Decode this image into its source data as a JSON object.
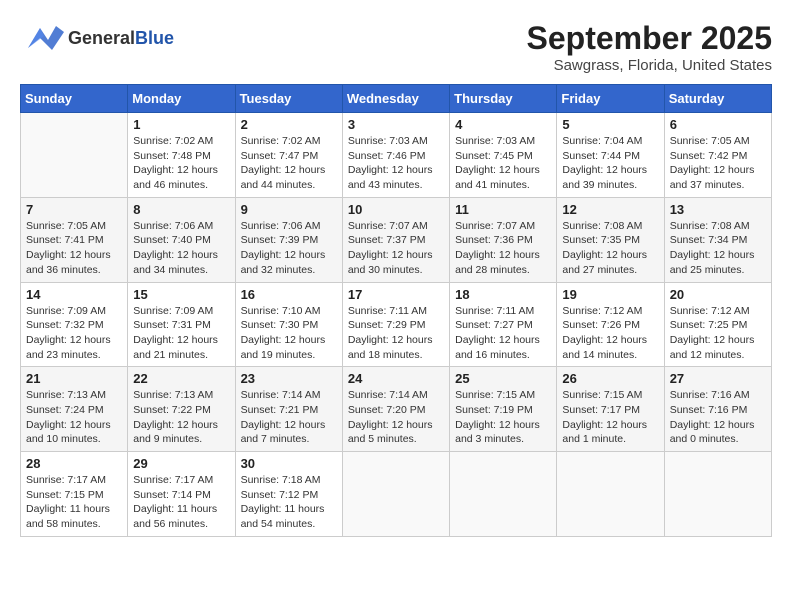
{
  "header": {
    "logo_general": "General",
    "logo_blue": "Blue",
    "title": "September 2025",
    "subtitle": "Sawgrass, Florida, United States"
  },
  "weekdays": [
    "Sunday",
    "Monday",
    "Tuesday",
    "Wednesday",
    "Thursday",
    "Friday",
    "Saturday"
  ],
  "weeks": [
    [
      {
        "day": "",
        "info": ""
      },
      {
        "day": "1",
        "info": "Sunrise: 7:02 AM\nSunset: 7:48 PM\nDaylight: 12 hours\nand 46 minutes."
      },
      {
        "day": "2",
        "info": "Sunrise: 7:02 AM\nSunset: 7:47 PM\nDaylight: 12 hours\nand 44 minutes."
      },
      {
        "day": "3",
        "info": "Sunrise: 7:03 AM\nSunset: 7:46 PM\nDaylight: 12 hours\nand 43 minutes."
      },
      {
        "day": "4",
        "info": "Sunrise: 7:03 AM\nSunset: 7:45 PM\nDaylight: 12 hours\nand 41 minutes."
      },
      {
        "day": "5",
        "info": "Sunrise: 7:04 AM\nSunset: 7:44 PM\nDaylight: 12 hours\nand 39 minutes."
      },
      {
        "day": "6",
        "info": "Sunrise: 7:05 AM\nSunset: 7:42 PM\nDaylight: 12 hours\nand 37 minutes."
      }
    ],
    [
      {
        "day": "7",
        "info": "Sunrise: 7:05 AM\nSunset: 7:41 PM\nDaylight: 12 hours\nand 36 minutes."
      },
      {
        "day": "8",
        "info": "Sunrise: 7:06 AM\nSunset: 7:40 PM\nDaylight: 12 hours\nand 34 minutes."
      },
      {
        "day": "9",
        "info": "Sunrise: 7:06 AM\nSunset: 7:39 PM\nDaylight: 12 hours\nand 32 minutes."
      },
      {
        "day": "10",
        "info": "Sunrise: 7:07 AM\nSunset: 7:37 PM\nDaylight: 12 hours\nand 30 minutes."
      },
      {
        "day": "11",
        "info": "Sunrise: 7:07 AM\nSunset: 7:36 PM\nDaylight: 12 hours\nand 28 minutes."
      },
      {
        "day": "12",
        "info": "Sunrise: 7:08 AM\nSunset: 7:35 PM\nDaylight: 12 hours\nand 27 minutes."
      },
      {
        "day": "13",
        "info": "Sunrise: 7:08 AM\nSunset: 7:34 PM\nDaylight: 12 hours\nand 25 minutes."
      }
    ],
    [
      {
        "day": "14",
        "info": "Sunrise: 7:09 AM\nSunset: 7:32 PM\nDaylight: 12 hours\nand 23 minutes."
      },
      {
        "day": "15",
        "info": "Sunrise: 7:09 AM\nSunset: 7:31 PM\nDaylight: 12 hours\nand 21 minutes."
      },
      {
        "day": "16",
        "info": "Sunrise: 7:10 AM\nSunset: 7:30 PM\nDaylight: 12 hours\nand 19 minutes."
      },
      {
        "day": "17",
        "info": "Sunrise: 7:11 AM\nSunset: 7:29 PM\nDaylight: 12 hours\nand 18 minutes."
      },
      {
        "day": "18",
        "info": "Sunrise: 7:11 AM\nSunset: 7:27 PM\nDaylight: 12 hours\nand 16 minutes."
      },
      {
        "day": "19",
        "info": "Sunrise: 7:12 AM\nSunset: 7:26 PM\nDaylight: 12 hours\nand 14 minutes."
      },
      {
        "day": "20",
        "info": "Sunrise: 7:12 AM\nSunset: 7:25 PM\nDaylight: 12 hours\nand 12 minutes."
      }
    ],
    [
      {
        "day": "21",
        "info": "Sunrise: 7:13 AM\nSunset: 7:24 PM\nDaylight: 12 hours\nand 10 minutes."
      },
      {
        "day": "22",
        "info": "Sunrise: 7:13 AM\nSunset: 7:22 PM\nDaylight: 12 hours\nand 9 minutes."
      },
      {
        "day": "23",
        "info": "Sunrise: 7:14 AM\nSunset: 7:21 PM\nDaylight: 12 hours\nand 7 minutes."
      },
      {
        "day": "24",
        "info": "Sunrise: 7:14 AM\nSunset: 7:20 PM\nDaylight: 12 hours\nand 5 minutes."
      },
      {
        "day": "25",
        "info": "Sunrise: 7:15 AM\nSunset: 7:19 PM\nDaylight: 12 hours\nand 3 minutes."
      },
      {
        "day": "26",
        "info": "Sunrise: 7:15 AM\nSunset: 7:17 PM\nDaylight: 12 hours\nand 1 minute."
      },
      {
        "day": "27",
        "info": "Sunrise: 7:16 AM\nSunset: 7:16 PM\nDaylight: 12 hours\nand 0 minutes."
      }
    ],
    [
      {
        "day": "28",
        "info": "Sunrise: 7:17 AM\nSunset: 7:15 PM\nDaylight: 11 hours\nand 58 minutes."
      },
      {
        "day": "29",
        "info": "Sunrise: 7:17 AM\nSunset: 7:14 PM\nDaylight: 11 hours\nand 56 minutes."
      },
      {
        "day": "30",
        "info": "Sunrise: 7:18 AM\nSunset: 7:12 PM\nDaylight: 11 hours\nand 54 minutes."
      },
      {
        "day": "",
        "info": ""
      },
      {
        "day": "",
        "info": ""
      },
      {
        "day": "",
        "info": ""
      },
      {
        "day": "",
        "info": ""
      }
    ]
  ]
}
